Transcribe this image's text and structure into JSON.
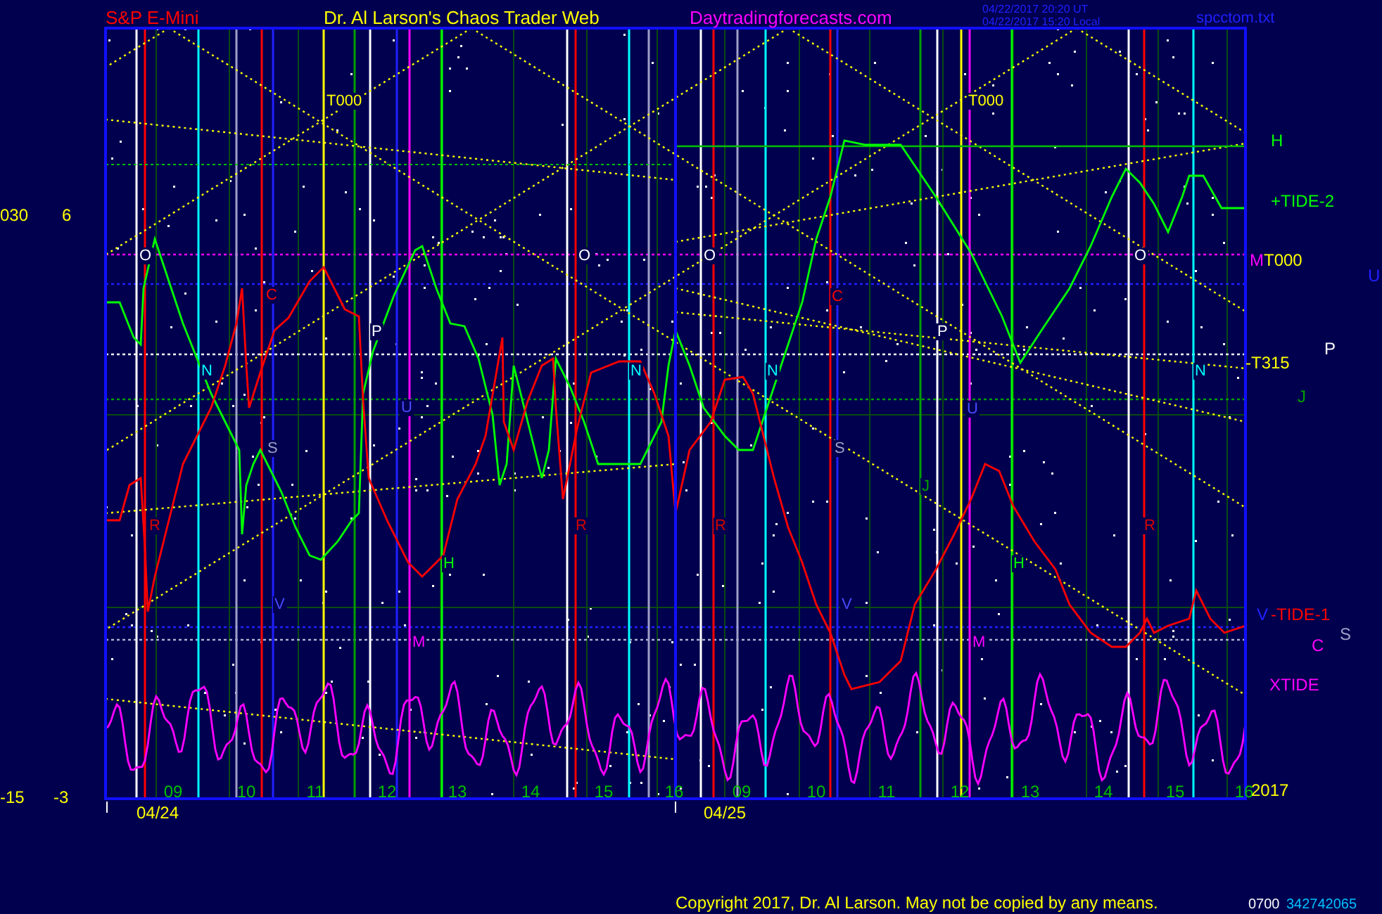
{
  "header": {
    "symbol": "S&P E-Mini",
    "title": "Dr. Al Larson's Chaos Trader Web",
    "site": "Daytradingforecasts.com",
    "utc_time": "04/22/2017 20:20 UT",
    "local_time": "04/22/2017 15:20 Local",
    "file": "spcctom.txt"
  },
  "left_axis": [
    {
      "text": "030"
    },
    {
      "text": "6"
    },
    {
      "text": "-15"
    },
    {
      "text": "-3"
    }
  ],
  "chart_labels": [
    {
      "text": "T000",
      "color": "#ffff00"
    },
    {
      "text": "T000",
      "color": "#ffff00"
    },
    {
      "text": "O",
      "color": "#ffffff"
    },
    {
      "text": "O",
      "color": "#ffffff"
    },
    {
      "text": "O",
      "color": "#ffffff"
    },
    {
      "text": "O",
      "color": "#ffffff"
    },
    {
      "text": "C",
      "color": "#ff0000"
    },
    {
      "text": "C",
      "color": "#ff0000"
    },
    {
      "text": "P",
      "color": "#ffffff"
    },
    {
      "text": "P",
      "color": "#ffffff"
    },
    {
      "text": "N",
      "color": "#00ffff"
    },
    {
      "text": "N",
      "color": "#00ffff"
    },
    {
      "text": "N",
      "color": "#00ffff"
    },
    {
      "text": "N",
      "color": "#00ffff"
    },
    {
      "text": "U",
      "color": "#4a4aff"
    },
    {
      "text": "U",
      "color": "#4a4aff"
    },
    {
      "text": "S",
      "color": "#a0a0c8"
    },
    {
      "text": "S",
      "color": "#a0a0c8"
    },
    {
      "text": "J",
      "color": "#00a000"
    },
    {
      "text": "R",
      "color": "#d00000"
    },
    {
      "text": "R",
      "color": "#d00000"
    },
    {
      "text": "R",
      "color": "#d00000"
    },
    {
      "text": "R",
      "color": "#d00000"
    },
    {
      "text": "H",
      "color": "#00ff00"
    },
    {
      "text": "H",
      "color": "#00ff00"
    },
    {
      "text": "V",
      "color": "#4a4aff"
    },
    {
      "text": "V",
      "color": "#4a4aff"
    },
    {
      "text": "M",
      "color": "#ff00ff"
    },
    {
      "text": "M",
      "color": "#ff00ff"
    }
  ],
  "right_labels": [
    {
      "text": "H",
      "color": "#00ff00"
    },
    {
      "text": "+TIDE-2",
      "color": "#00ff00"
    },
    {
      "text": "M",
      "color": "#ff00ff"
    },
    {
      "text": "T000",
      "color": "#ffff00"
    },
    {
      "text": "U",
      "color": "#2020ff"
    },
    {
      "text": "P",
      "color": "#ffffff"
    },
    {
      "text": "-T315",
      "color": "#ffff00"
    },
    {
      "text": "J",
      "color": "#00a000"
    },
    {
      "text": "V",
      "color": "#2020ff"
    },
    {
      "text": "-TIDE-1",
      "color": "#ff0000"
    },
    {
      "text": "S",
      "color": "#a0a0c8"
    },
    {
      "text": "C",
      "color": "#ff00ff"
    },
    {
      "text": "XTIDE",
      "color": "#ff00ff"
    }
  ],
  "time_axis": {
    "hours": [
      "09",
      "10",
      "11",
      "12",
      "13",
      "14",
      "15",
      "16",
      "09",
      "10",
      "11",
      "12",
      "13",
      "14",
      "15",
      "16"
    ],
    "dates": [
      "04/24",
      "04/25"
    ],
    "year": "2017"
  },
  "footer": {
    "copyright": "Copyright 2017, Dr. Al Larson. May not be copied by any means.",
    "time": "0700",
    "code": "342742065"
  }
}
